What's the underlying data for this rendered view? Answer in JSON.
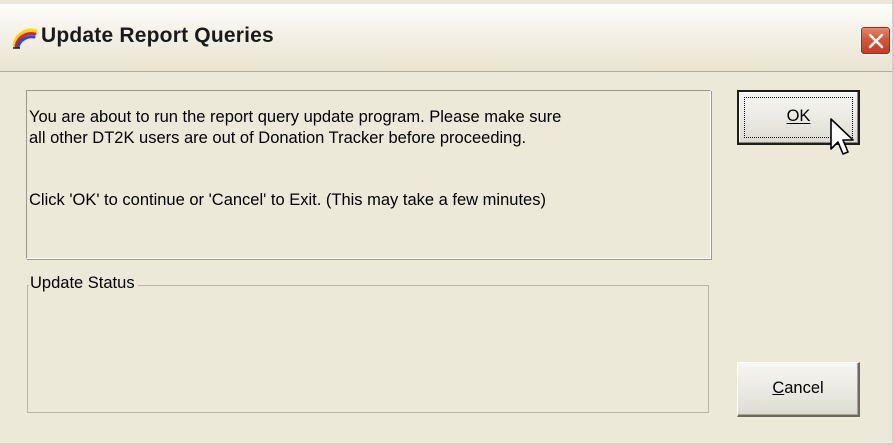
{
  "window": {
    "title": "Update Report Queries",
    "icon": "rainbow-arc-icon",
    "close_icon": "close-icon",
    "close_color": "#d8553a"
  },
  "message": {
    "line1": "You are about to run the report query update program.  Please make sure",
    "line2": "all other DT2K users are out of Donation Tracker before proceeding.",
    "line3": "Click 'OK' to continue or 'Cancel' to Exit.    (This may take a few minutes)"
  },
  "status_group": {
    "legend": "Update Status",
    "content": ""
  },
  "buttons": {
    "ok": {
      "mnemonic": "O",
      "rest": "K",
      "focused": true
    },
    "cancel": {
      "mnemonic": "C",
      "rest": "ancel"
    }
  },
  "cursor": {
    "icon": "mouse-pointer-icon"
  }
}
